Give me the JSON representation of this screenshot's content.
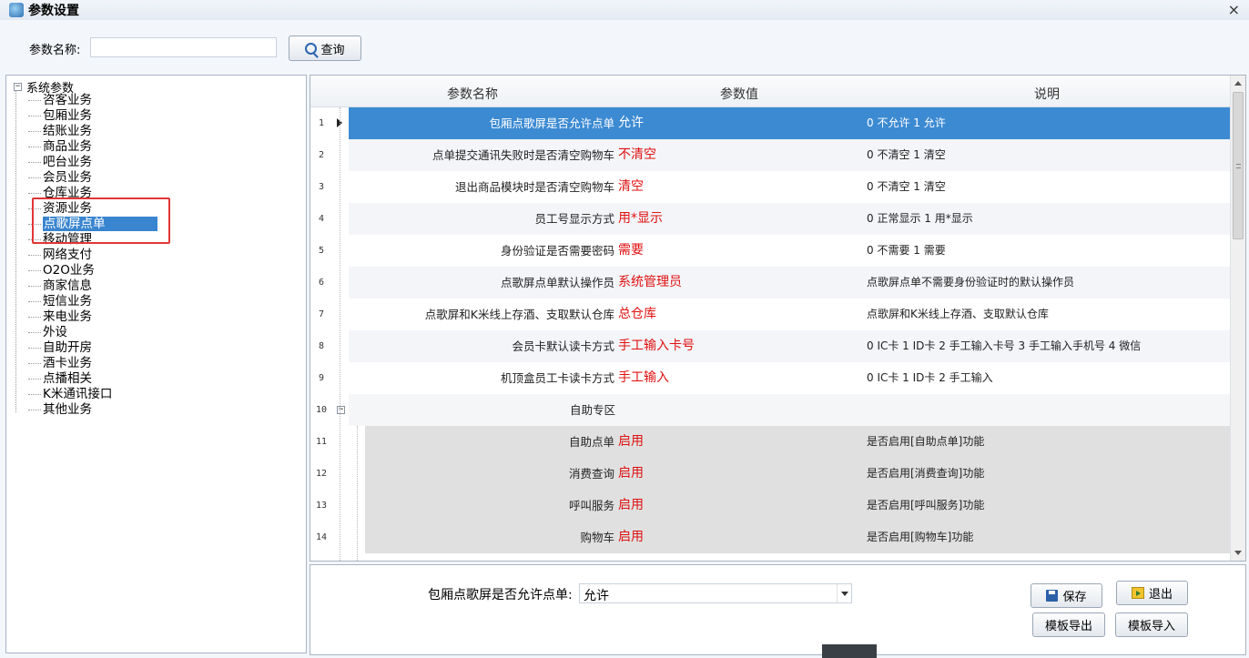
{
  "window": {
    "title": "参数设置",
    "close": "×"
  },
  "search": {
    "label": "参数名称:",
    "value": "",
    "button": "查询"
  },
  "tree": {
    "root": "系统参数",
    "root_toggle": "−",
    "items": [
      "咨客业务",
      "包厢业务",
      "结账业务",
      "商品业务",
      "吧台业务",
      "会员业务",
      "仓库业务",
      "资源业务",
      "点歌屏点单",
      "移动管理",
      "网络支付",
      "O2O业务",
      "商家信息",
      "短信业务",
      "来电业务",
      "外设",
      "自助开房",
      "酒卡业务",
      "点播相关",
      "K米通讯接口",
      "其他业务"
    ],
    "selected": "点歌屏点单"
  },
  "grid": {
    "headers": {
      "name": "参数名称",
      "value": "参数值",
      "desc": "说明"
    },
    "rows": [
      {
        "num": "1",
        "name": "包厢点歌屏是否允许点单",
        "value": "允许",
        "desc": "0 不允许 1 允许"
      },
      {
        "num": "2",
        "name": "点单提交通讯失败时是否清空购物车",
        "value": "不清空",
        "desc": "0 不清空 1 清空"
      },
      {
        "num": "3",
        "name": "退出商品模块时是否清空购物车",
        "value": "清空",
        "desc": "0 不清空 1 清空"
      },
      {
        "num": "4",
        "name": "员工号显示方式",
        "value": "用*显示",
        "desc": "0 正常显示 1 用*显示"
      },
      {
        "num": "5",
        "name": "身份验证是否需要密码",
        "value": "需要",
        "desc": "0 不需要 1 需要"
      },
      {
        "num": "6",
        "name": "点歌屏点单默认操作员",
        "value": "系统管理员",
        "desc": "点歌屏点单不需要身份验证时的默认操作员"
      },
      {
        "num": "7",
        "name": "点歌屏和K米线上存酒、支取默认仓库",
        "value": "总仓库",
        "desc": "点歌屏和K米线上存酒、支取默认仓库"
      },
      {
        "num": "8",
        "name": "会员卡默认读卡方式",
        "value": "手工输入卡号",
        "desc": "0 IC卡  1 ID卡  2 手工输入卡号 3 手工输入手机号 4 微信"
      },
      {
        "num": "9",
        "name": "机顶盒员工卡读卡方式",
        "value": "手工输入",
        "desc": "0 IC卡  1 ID卡  2 手工输入"
      }
    ],
    "group": {
      "num": "10",
      "name": "自助专区",
      "toggle": "−"
    },
    "group_rows": [
      {
        "num": "11",
        "name": "自助点单",
        "value": "启用",
        "desc": "是否启用[自助点单]功能"
      },
      {
        "num": "12",
        "name": "消费查询",
        "value": "启用",
        "desc": "是否启用[消费查询]功能"
      },
      {
        "num": "13",
        "name": "呼叫服务",
        "value": "启用",
        "desc": "是否启用[呼叫服务]功能"
      },
      {
        "num": "14",
        "name": "购物车",
        "value": "启用",
        "desc": "是否启用[购物车]功能"
      }
    ]
  },
  "editor": {
    "label": "包厢点歌屏是否允许点单:",
    "selected": "允许",
    "buttons": {
      "save": "保存",
      "exit": "退出",
      "export": "模板导出",
      "import": "模板导入"
    }
  }
}
